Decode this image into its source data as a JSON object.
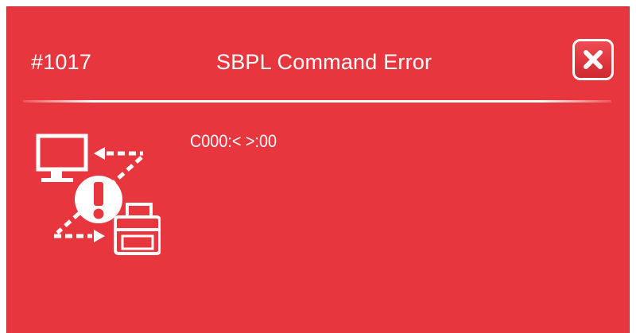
{
  "dialog": {
    "code": "#1017",
    "title": "SBPL Command Error",
    "message": "C000:< >:00",
    "close_icon": "close-x-icon",
    "illustration_icon": "printer-communication-error-icon",
    "background_color": "#e8363e",
    "text_color": "#ffffff"
  }
}
